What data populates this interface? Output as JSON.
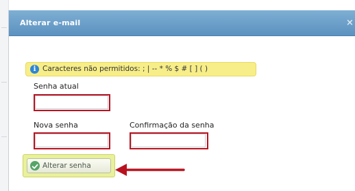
{
  "dialog": {
    "title": "Alterar e-mail",
    "close_label": "×"
  },
  "banner": {
    "icon": "info-icon",
    "icon_glyph": "i",
    "text": "Caracteres não permitidos: ; | -- * % $ # [ ] ( )"
  },
  "form": {
    "current_password_label": "Senha atual",
    "current_password_value": "",
    "new_password_label": "Nova senha",
    "new_password_value": "",
    "confirm_password_label": "Confirmação da senha",
    "confirm_password_value": "",
    "submit_label": "Alterar senha",
    "submit_icon": "check-circle-icon"
  },
  "annotations": {
    "highlight_color": "#b8121f",
    "arrow_color": "#b8121f"
  }
}
